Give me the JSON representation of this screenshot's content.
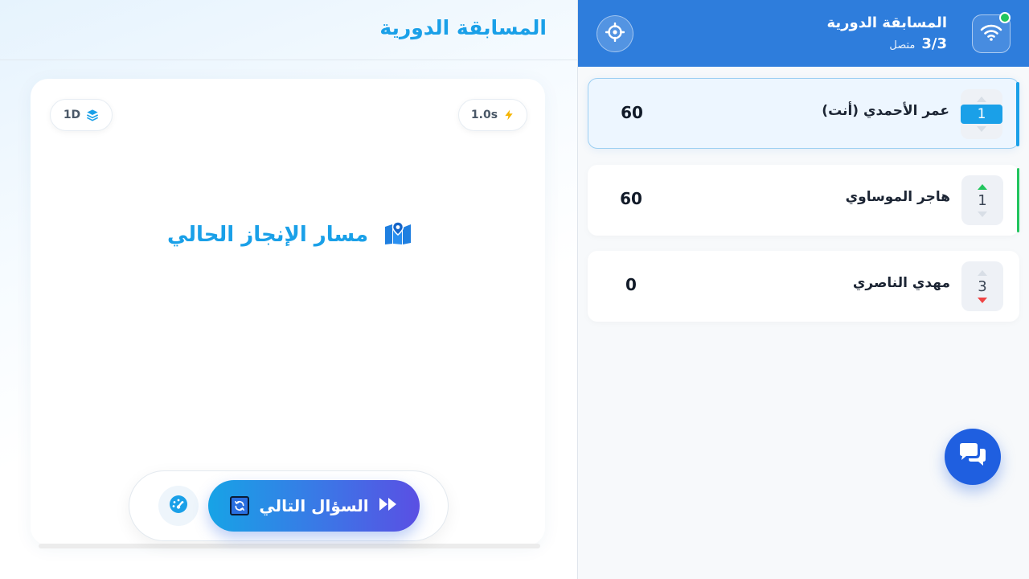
{
  "main": {
    "title": "المسابقة الدورية",
    "mode_badge": "1D",
    "speed_badge": "1.0s",
    "progress_title": "مسار الإنجاز الحالي",
    "next_button_label": "السؤال التالي"
  },
  "sidebar": {
    "title": "المسابقة الدورية",
    "connected_count": "3/3",
    "connected_label": "متصل",
    "players": [
      {
        "rank": "1",
        "name": "عمر الأحمدي (أنت)",
        "score": "60",
        "trend": "none",
        "is_me": true
      },
      {
        "rank": "1",
        "name": "هاجر الموساوي",
        "score": "60",
        "trend": "up",
        "is_me": false
      },
      {
        "rank": "3",
        "name": "مهدي الناصري",
        "score": "0",
        "trend": "down",
        "is_me": false
      }
    ]
  },
  "colors": {
    "accent": "#1aa0e8",
    "header_blue": "#2e7ddc",
    "online": "#22c55e",
    "trend_up": "#22c55e",
    "trend_down": "#ef4444"
  },
  "icons": {
    "mode": "layers-icon",
    "speed": "lightning-icon",
    "progress": "map-icon",
    "speed_control": "speedometer-icon",
    "next": "fast-forward-icon",
    "refresh": "refresh-icon",
    "connection": "wifi-icon",
    "target": "crosshair-icon",
    "chat": "chat-icon"
  }
}
